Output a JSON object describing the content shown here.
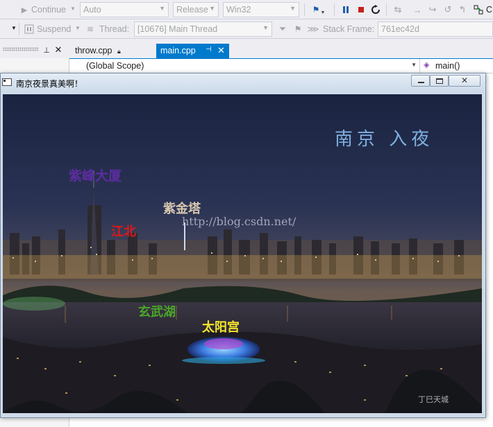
{
  "toolbar1": {
    "continue_label": "Continue",
    "solution_config": "Auto",
    "build_config": "Release",
    "platform": "Win32"
  },
  "toolbar2": {
    "suspend_label": "Suspend",
    "thread_label": "Thread:",
    "thread_value": "[10676] Main Thread",
    "stack_frame_label": "Stack Frame:",
    "stack_frame_value": "761ec42d"
  },
  "tabs": [
    {
      "label": "throw.cpp",
      "active": false
    },
    {
      "label": "main.cpp",
      "active": true
    }
  ],
  "navbar": {
    "scope": "(Global Scope)",
    "member": "main()"
  },
  "console_window": {
    "title": "南京夜景真美啊！",
    "image": {
      "headline": "南京 入夜",
      "labels": {
        "zifeng": "紫峰大厦",
        "jiangbei": "江北",
        "zijinta": "紫金塔",
        "xuanwuhu": "玄武湖",
        "taiyanggong": "太阳宫"
      },
      "watermark": "http://blog.csdn.net/",
      "signature": "丁巳天城"
    }
  },
  "colors": {
    "accent": "#007acc",
    "label_zifeng": "#5b2d9e",
    "label_jiangbei": "#e01818",
    "label_zijinta": "#d9c8b0",
    "label_xuanwuhu": "#4aa628",
    "label_taiyanggong": "#f5e52a",
    "headline": "#7fb0e0"
  }
}
